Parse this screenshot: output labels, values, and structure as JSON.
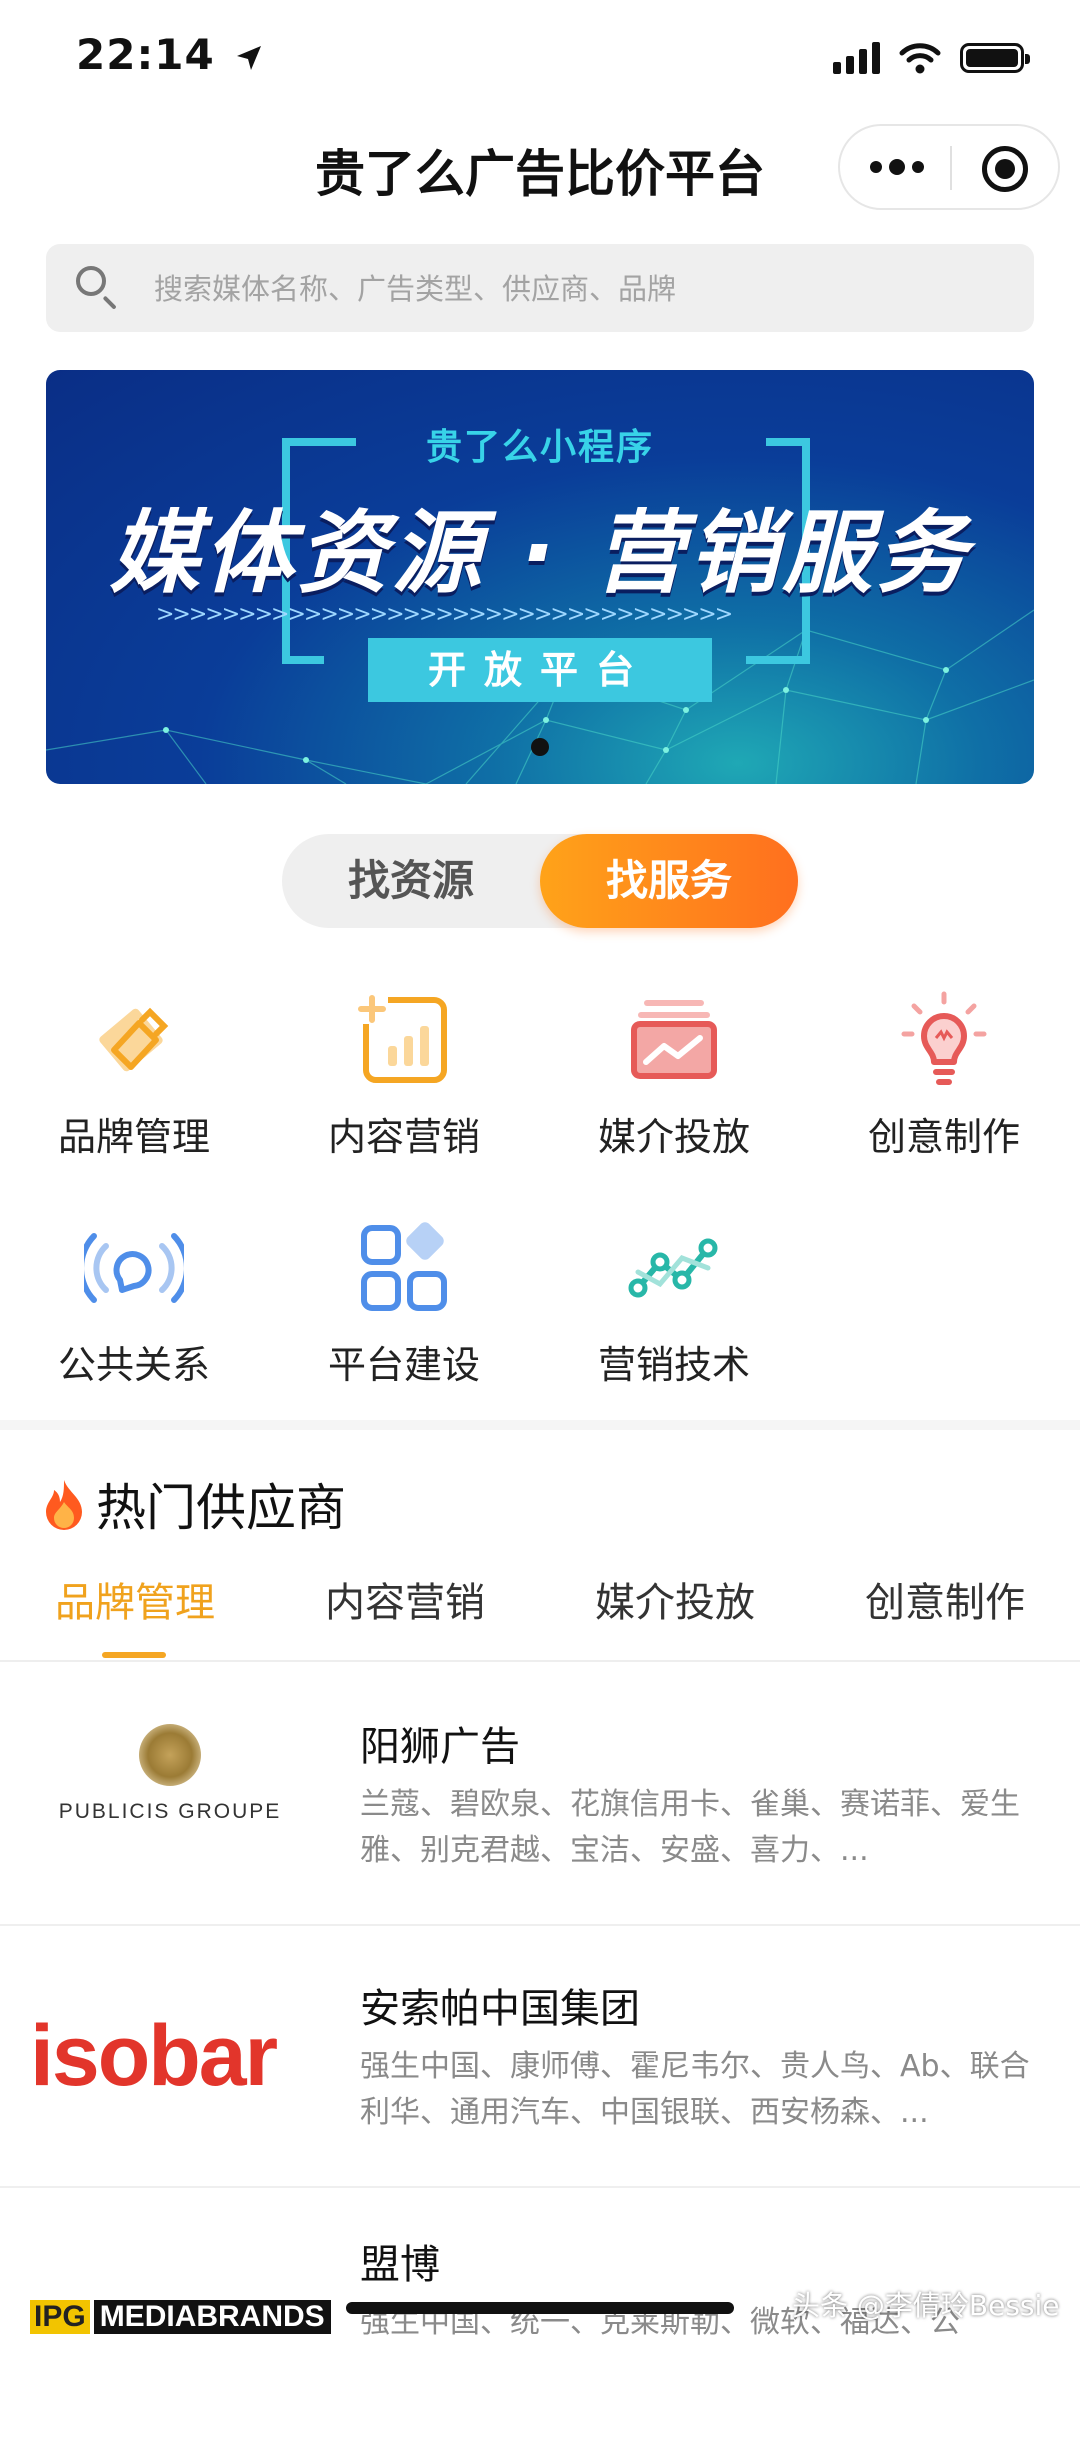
{
  "status": {
    "time": "22:14"
  },
  "nav": {
    "title": "贵了么广告比价平台"
  },
  "search": {
    "placeholder": "搜索媒体名称、广告类型、供应商、品牌"
  },
  "banner": {
    "subtitle": "贵了么小程序",
    "headline": "媒体资源 · 营销服务",
    "tag": "开放平台"
  },
  "segment": {
    "left_label": "找资源",
    "right_label": "找服务",
    "selected": "找服务"
  },
  "categories": [
    {
      "label": "品牌管理",
      "icon": "brand-icon"
    },
    {
      "label": "内容营销",
      "icon": "chart-add-icon"
    },
    {
      "label": "媒介投放",
      "icon": "media-chart-icon"
    },
    {
      "label": "创意制作",
      "icon": "lightbulb-icon"
    },
    {
      "label": "公共关系",
      "icon": "broadcast-icon"
    },
    {
      "label": "平台建设",
      "icon": "grid-icon"
    },
    {
      "label": "营销技术",
      "icon": "network-icon"
    }
  ],
  "hot": {
    "title": "热门供应商",
    "tabs": [
      "品牌管理",
      "内容营销",
      "媒介投放",
      "创意制作"
    ],
    "active_tab": "品牌管理",
    "suppliers": [
      {
        "name": "阳狮广告",
        "logo_text": "PUBLICIS GROUPE",
        "desc": "兰蔻、碧欧泉、花旗信用卡、雀巢、赛诺菲、爱生雅、别克君越、宝洁、安盛、喜力、..."
      },
      {
        "name": "安索帕中国集团",
        "logo_text": "isobar",
        "desc": "强生中国、康师傅、霍尼韦尔、贵人鸟、Ab、联合利华、通用汽车、中国银联、西安杨森、..."
      },
      {
        "name": "盟博",
        "logo_text_a": "IPG",
        "logo_text_b": "MEDIABRANDS",
        "desc": "强生中国、统一、克莱斯勒、微软、福达、公"
      }
    ]
  },
  "watermark": "头条 @李倩玲Bessie",
  "colors": {
    "accent": "#f5a623",
    "orange_gradient_start": "#ffa319",
    "orange_gradient_end": "#ff6f1e"
  }
}
